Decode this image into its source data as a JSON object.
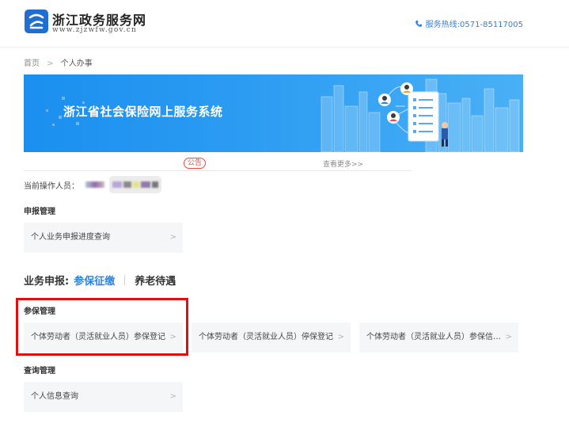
{
  "header": {
    "site_name": "浙江政务服务网",
    "site_url": "www.zjzwfw.gov.cn",
    "hotline": "服务热线:0571-85117005",
    "brand_color": "#1f6fd2",
    "accent_color": "#2a82e4"
  },
  "breadcrumb": {
    "home": "首页",
    "separator": ">",
    "current": "个人办事"
  },
  "banner": {
    "title": "浙江省社会保险网上服务系统"
  },
  "notice": {
    "badge": "公告",
    "more": "查看更多>>"
  },
  "operator": {
    "label": "当前操作人员："
  },
  "declare_section": {
    "title": "申报管理",
    "items": [
      {
        "label": "个人业务申报进度查询"
      }
    ]
  },
  "business": {
    "label": "业务申报:",
    "tabs": [
      {
        "label": "参保征缴",
        "active": true
      },
      {
        "label": "养老待遇",
        "active": false
      }
    ]
  },
  "insured_section": {
    "title": "参保管理",
    "items": [
      {
        "label": "个体劳动者（灵活就业人员）参保登记"
      },
      {
        "label": "个体劳动者（灵活就业人员）停保登记"
      },
      {
        "label": "个体劳动者（灵活就业人员）参保信息变..."
      }
    ]
  },
  "query_section": {
    "title": "查询管理",
    "items": [
      {
        "label": "个人信息查询"
      }
    ]
  },
  "card_arrow": ">"
}
